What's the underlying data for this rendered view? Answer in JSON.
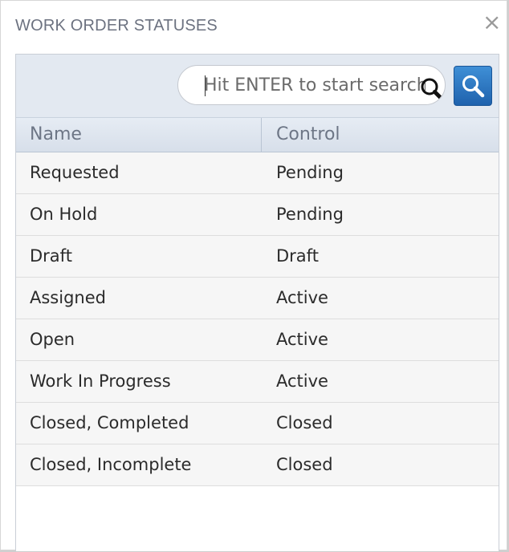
{
  "dialog": {
    "title": "WORK ORDER STATUSES",
    "close_label": "×"
  },
  "search": {
    "placeholder": "Hit ENTER to start search",
    "value": ""
  },
  "table": {
    "columns": {
      "name": "Name",
      "control": "Control"
    },
    "rows": [
      {
        "name": "Requested",
        "control": "Pending"
      },
      {
        "name": "On Hold",
        "control": "Pending"
      },
      {
        "name": "Draft",
        "control": "Draft"
      },
      {
        "name": "Assigned",
        "control": "Active"
      },
      {
        "name": "Open",
        "control": "Active"
      },
      {
        "name": "Work In Progress",
        "control": "Active"
      },
      {
        "name": "Closed, Completed",
        "control": "Closed"
      },
      {
        "name": "Closed, Incomplete",
        "control": "Closed"
      }
    ]
  },
  "icons": {
    "inline_search": "magnifier-icon",
    "search_button": "search-icon"
  },
  "colors": {
    "accent": "#2a74c3",
    "title": "#6c7280",
    "header_bg": "#dde4ee"
  }
}
